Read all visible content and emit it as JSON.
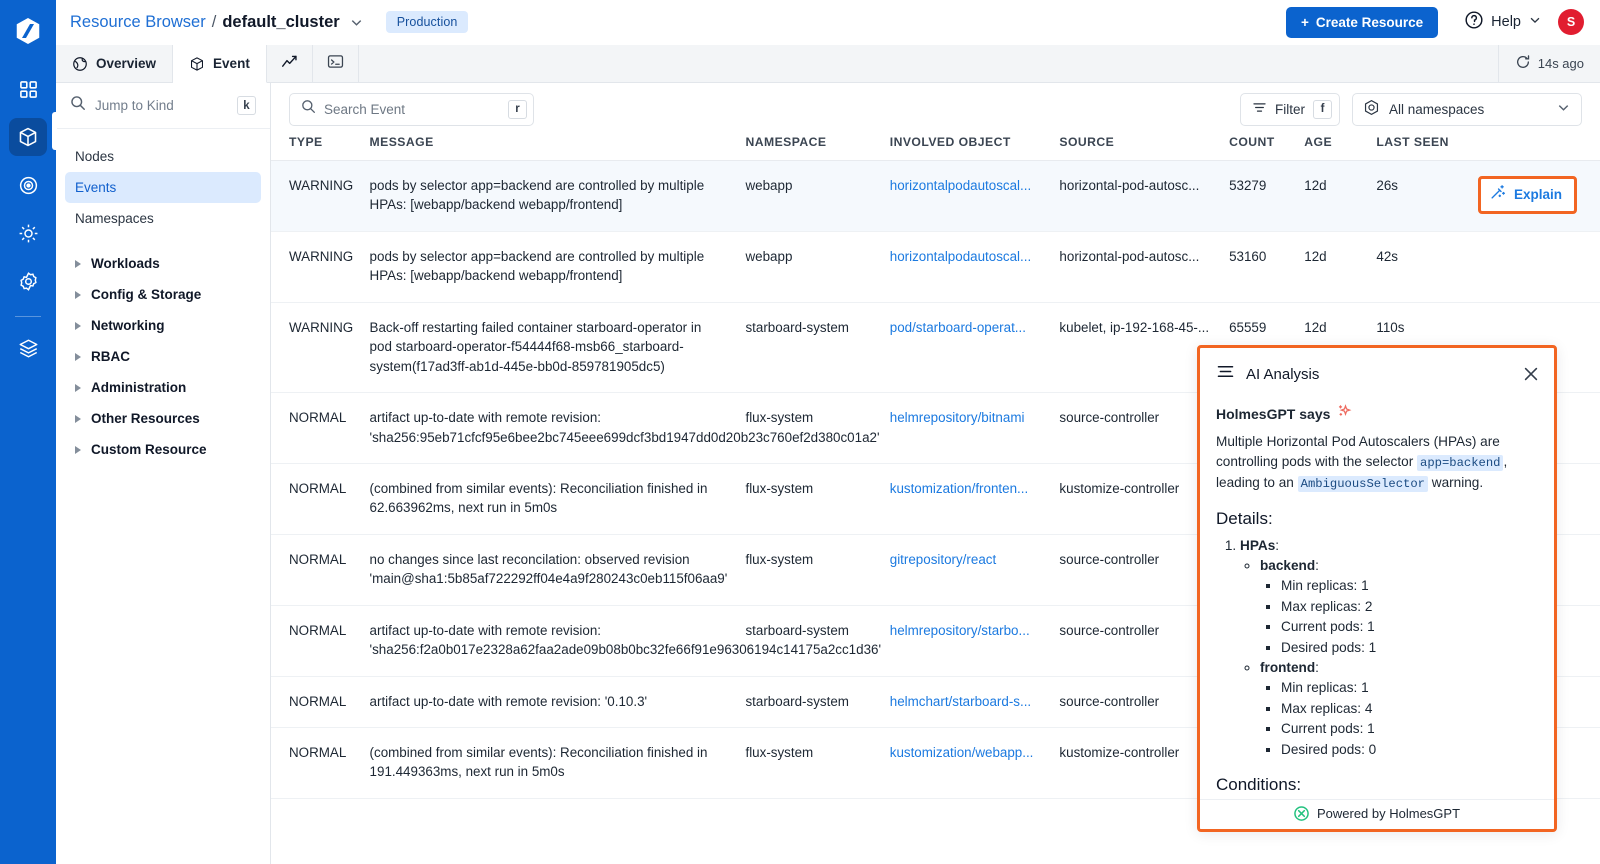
{
  "rail": {
    "logo": "hashicorp-logo-icon",
    "items": [
      {
        "name": "dashboard-icon",
        "active": false
      },
      {
        "name": "cube-icon",
        "active": true
      },
      {
        "name": "target-icon",
        "active": false
      },
      {
        "name": "gear-sun-icon",
        "active": false
      },
      {
        "name": "settings-icon",
        "active": false
      },
      {
        "name": "layers-icon",
        "active": false
      }
    ]
  },
  "header": {
    "breadcrumb_root": "Resource Browser",
    "breadcrumb_sep": "/",
    "breadcrumb_current": "default_cluster",
    "env_badge": "Production",
    "create_button": "Create Resource",
    "create_plus": "+",
    "help_label": "Help",
    "avatar_initial": "S"
  },
  "tabs": {
    "items": [
      {
        "label": "Overview",
        "icon": "globe-icon",
        "active": false
      },
      {
        "label": "Event",
        "icon": "cube-icon",
        "active": true
      }
    ],
    "mini_icons": [
      "chart-line-icon",
      "terminal-icon"
    ],
    "refresh_label": "14s ago",
    "refresh_icon": "refresh-icon"
  },
  "sidebar": {
    "search_placeholder": "Jump to Kind",
    "search_kbd": "k",
    "items": [
      {
        "label": "Nodes",
        "group": false,
        "active": false
      },
      {
        "label": "Events",
        "group": false,
        "active": true
      },
      {
        "label": "Namespaces",
        "group": false,
        "active": false
      },
      {
        "label": "Workloads",
        "group": true,
        "active": false
      },
      {
        "label": "Config & Storage",
        "group": true,
        "active": false
      },
      {
        "label": "Networking",
        "group": true,
        "active": false
      },
      {
        "label": "RBAC",
        "group": true,
        "active": false
      },
      {
        "label": "Administration",
        "group": true,
        "active": false
      },
      {
        "label": "Other Resources",
        "group": true,
        "active": false
      },
      {
        "label": "Custom Resource",
        "group": true,
        "active": false
      }
    ]
  },
  "toolbar": {
    "search_placeholder": "Search Event",
    "search_kbd": "r",
    "filter_label": "Filter",
    "filter_kbd": "f",
    "namespace_value": "All namespaces"
  },
  "table": {
    "columns": [
      "TYPE",
      "MESSAGE",
      "NAMESPACE",
      "INVOLVED OBJECT",
      "SOURCE",
      "COUNT",
      "AGE",
      "LAST SEEN",
      ""
    ],
    "explain_label": "Explain",
    "rows": [
      {
        "type": "WARNING",
        "message": "pods by selector app=backend are controlled by multiple HPAs: [webapp/backend webapp/frontend]",
        "namespace": "webapp",
        "involved_object": "horizontalpodautoscal...",
        "source": "horizontal-pod-autosc...",
        "count": "53279",
        "age": "12d",
        "last_seen": "26s",
        "highlighted": true,
        "has_explain": true
      },
      {
        "type": "WARNING",
        "message": "pods by selector app=backend are controlled by multiple HPAs: [webapp/backend webapp/frontend]",
        "namespace": "webapp",
        "involved_object": "horizontalpodautoscal...",
        "source": "horizontal-pod-autosc...",
        "count": "53160",
        "age": "12d",
        "last_seen": "42s",
        "highlighted": false,
        "has_explain": false
      },
      {
        "type": "WARNING",
        "message": "Back-off restarting failed container starboard-operator in pod starboard-operator-f54444f68-msb66_starboard-system(f17ad3ff-ab1d-445e-bb0d-859781905dc5)",
        "namespace": "starboard-system",
        "involved_object": "pod/starboard-operat...",
        "source": "kubelet, ip-192-168-45-...",
        "count": "65559",
        "age": "12d",
        "last_seen": "110s",
        "highlighted": false,
        "has_explain": false
      },
      {
        "type": "NORMAL",
        "message": "artifact up-to-date with remote revision: 'sha256:95eb71cfcf95e6bee2bc745eee699dcf3bd1947dd0d20b23c760ef2d380c01a2'",
        "namespace": "flux-system",
        "involved_object": "helmrepository/bitnami",
        "source": "source-controller",
        "count": "",
        "age": "",
        "last_seen": "",
        "highlighted": false,
        "has_explain": false
      },
      {
        "type": "NORMAL",
        "message": "(combined from similar events): Reconciliation finished in 62.663962ms, next run in 5m0s",
        "namespace": "flux-system",
        "involved_object": "kustomization/fronten...",
        "source": "kustomize-controller",
        "count": "",
        "age": "",
        "last_seen": "",
        "highlighted": false,
        "has_explain": false
      },
      {
        "type": "NORMAL",
        "message": "no changes since last reconcilation: observed revision 'main@sha1:5b85af722292ff04e4a9f280243c0eb115f06aa9'",
        "namespace": "flux-system",
        "involved_object": "gitrepository/react",
        "source": "source-controller",
        "count": "",
        "age": "",
        "last_seen": "",
        "highlighted": false,
        "has_explain": false
      },
      {
        "type": "NORMAL",
        "message": "artifact up-to-date with remote revision: 'sha256:f2a0b017e2328a62faa2ade09b08b0bc32fe66f91e96306194c14175a2cc1d36'",
        "namespace": "starboard-system",
        "involved_object": "helmrepository/starbo...",
        "source": "source-controller",
        "count": "",
        "age": "",
        "last_seen": "",
        "highlighted": false,
        "has_explain": false
      },
      {
        "type": "NORMAL",
        "message": "artifact up-to-date with remote revision: '0.10.3'",
        "namespace": "starboard-system",
        "involved_object": "helmchart/starboard-s...",
        "source": "source-controller",
        "count": "",
        "age": "",
        "last_seen": "",
        "highlighted": false,
        "has_explain": false
      },
      {
        "type": "NORMAL",
        "message": "(combined from similar events): Reconciliation finished in 191.449363ms, next run in 5m0s",
        "namespace": "flux-system",
        "involved_object": "kustomization/webapp...",
        "source": "kustomize-controller",
        "count": "",
        "age": "",
        "last_seen": "",
        "highlighted": false,
        "has_explain": false
      }
    ]
  },
  "ai_panel": {
    "title": "AI Analysis",
    "menu_icon": "list-icon",
    "close_icon": "close-icon",
    "says_label": "HolmesGPT says",
    "sparkle_icon": "sparkle-icon",
    "summary_part1": "Multiple Horizontal Pod Autoscalers (HPAs) are controlling pods with the selector ",
    "summary_code1": "app=backend",
    "summary_part2": ", leading to an ",
    "summary_code2": "AmbiguousSelector",
    "summary_part3": " warning.",
    "details_heading": "Details:",
    "list_item_1": "HPAs",
    "hpa_backend_label": "backend",
    "hpa_backend": [
      "Min replicas: 1",
      "Max replicas: 2",
      "Current pods: 1",
      "Desired pods: 1"
    ],
    "hpa_frontend_label": "frontend",
    "hpa_frontend": [
      "Min replicas: 1",
      "Max replicas: 4",
      "Current pods: 1",
      "Desired pods: 0"
    ],
    "conditions_heading": "Conditions:",
    "footer_label": "Powered by HolmesGPT",
    "footer_icon": "holmesgpt-icon"
  },
  "colors": {
    "brand_blue": "#0b63ce",
    "link_blue": "#1c7ae0",
    "warning_red": "#ea3b2f",
    "accent_orange": "#f26522",
    "badge_blue_bg": "#dbeafe",
    "avatar_red": "#e11d30",
    "holmes_green": "#23c27f"
  }
}
